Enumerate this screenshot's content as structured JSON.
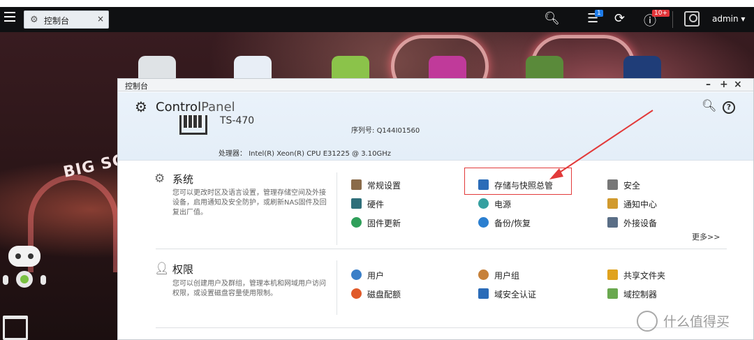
{
  "topbar": {
    "tab_label": "控制台",
    "tab_close": "×",
    "user": "admin ▾",
    "badge_tasks": "1",
    "badge_info": "10+"
  },
  "window": {
    "title": "控制台",
    "controls": [
      "–",
      "+",
      "×"
    ],
    "app_title_bold": "Control",
    "app_title_light": "Panel"
  },
  "system_info": {
    "model": "TS-470",
    "serial_label": "序列号:",
    "serial": "Q144I01560",
    "cpu_label": "处理器：",
    "cpu": "Intel(R) Xeon(R) CPU E31225 @ 3.10GHz"
  },
  "sections": {
    "system": {
      "title": "系统",
      "desc": "您可以更改时区及语言设置，管理存储空间及外接设备，启用通知及安全防护，或刷新NAS固件及回复出厂值。",
      "items": [
        {
          "label": "常规设置",
          "icon": "settings-icon",
          "color": "#8a6b4a"
        },
        {
          "label": "存储与快照总管",
          "icon": "storage-icon",
          "color": "#2b6cb8"
        },
        {
          "label": "安全",
          "icon": "lock-icon",
          "color": "#777777"
        },
        {
          "label": "硬件",
          "icon": "hardware-icon",
          "color": "#2f6f7a"
        },
        {
          "label": "电源",
          "icon": "power-icon",
          "color": "#36a0a0"
        },
        {
          "label": "通知中心",
          "icon": "notification-icon",
          "color": "#d19a2e"
        },
        {
          "label": "固件更新",
          "icon": "firmware-icon",
          "color": "#2f9f5a"
        },
        {
          "label": "备份/恢复",
          "icon": "backup-icon",
          "color": "#2b7fd0"
        },
        {
          "label": "外接设备",
          "icon": "external-device-icon",
          "color": "#5a6e86"
        }
      ],
      "more": "更多>>"
    },
    "privilege": {
      "title": "权限",
      "desc": "您可以创建用户及群组，管理本机和网域用户访问权限，或设置磁盘容量使用限制。",
      "items": [
        {
          "label": "用户",
          "icon": "user-icon",
          "color": "#3a7fc8"
        },
        {
          "label": "用户组",
          "icon": "user-group-icon",
          "color": "#c7813a"
        },
        {
          "label": "共享文件夹",
          "icon": "shared-folder-icon",
          "color": "#e0a21e"
        },
        {
          "label": "磁盘配额",
          "icon": "quota-icon",
          "color": "#e05a2a"
        },
        {
          "label": "域安全认证",
          "icon": "domain-security-icon",
          "color": "#2b6cb8"
        },
        {
          "label": "域控制器",
          "icon": "domain-controller-icon",
          "color": "#6aa84f"
        }
      ]
    }
  },
  "watermark": "什么值得买"
}
